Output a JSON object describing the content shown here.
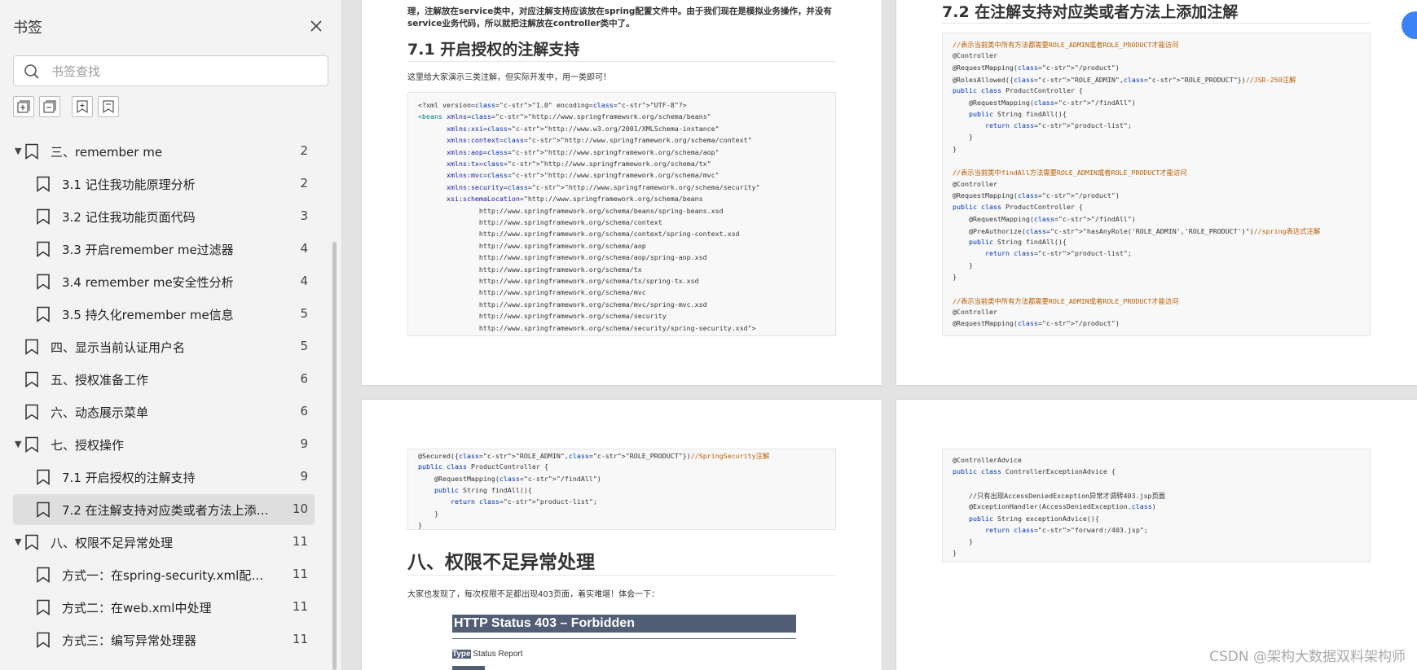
{
  "sidebar": {
    "title": "书签",
    "search_placeholder": "书签查找",
    "toolbar": [
      "expand-all",
      "collapse-all",
      "add-bookmark",
      "bookmark"
    ],
    "items": [
      {
        "label": "三、remember me",
        "page": "2",
        "level": 0,
        "expanded": true
      },
      {
        "label": "3.1 记住我功能原理分析",
        "page": "2",
        "level": 1
      },
      {
        "label": "3.2 记住我功能页面代码",
        "page": "3",
        "level": 1
      },
      {
        "label": "3.3 开启remember me过滤器",
        "page": "4",
        "level": 1
      },
      {
        "label": "3.4 remember me安全性分析",
        "page": "4",
        "level": 1
      },
      {
        "label": "3.5 持久化remember me信息",
        "page": "5",
        "level": 1
      },
      {
        "label": "四、显示当前认证用户名",
        "page": "5",
        "level": 0
      },
      {
        "label": "五、授权准备工作",
        "page": "6",
        "level": 0
      },
      {
        "label": "六、动态展示菜单",
        "page": "6",
        "level": 0
      },
      {
        "label": "七、授权操作",
        "page": "9",
        "level": 0,
        "expanded": true
      },
      {
        "label": "7.1 开启授权的注解支持",
        "page": "9",
        "level": 1
      },
      {
        "label": "7.2 在注解支持对应类或者方法上添加...",
        "page": "10",
        "level": 1,
        "active": true
      },
      {
        "label": "八、权限不足异常处理",
        "page": "11",
        "level": 0,
        "expanded": true
      },
      {
        "label": "方式一：在spring-security.xml配置文...",
        "page": "11",
        "level": 1
      },
      {
        "label": "方式二：在web.xml中处理",
        "page": "11",
        "level": 1
      },
      {
        "label": "方式三：编写异常处理器",
        "page": "11",
        "level": 1
      }
    ]
  },
  "page1": {
    "intro_lines": [
      "理，注解放在service类中，对应注解支持应该放在spring配置文件中。由于我们现在是模拟业务操作，并没有",
      "service业务代码，所以就把注解放在controller类中了。"
    ],
    "heading": "7.1 开启授权的注解支持",
    "para": "这里给大家演示三类注解，但实际开发中，用一类即可！",
    "code": [
      "<?xml version=\"1.0\" encoding=\"UTF-8\"?>",
      "<beans xmlns=\"http://www.springframework.org/schema/beans\"",
      "       xmlns:xsi=\"http://www.w3.org/2001/XMLSchema-instance\"",
      "       xmlns:context=\"http://www.springframework.org/schema/context\"",
      "       xmlns:aop=\"http://www.springframework.org/schema/aop\"",
      "       xmlns:tx=\"http://www.springframework.org/schema/tx\"",
      "       xmlns:mvc=\"http://www.springframework.org/schema/mvc\"",
      "       xmlns:security=\"http://www.springframework.org/schema/security\"",
      "       xsi:schemaLocation=\"http://www.springframework.org/schema/beans",
      "               http://www.springframework.org/schema/beans/spring-beans.xsd",
      "               http://www.springframework.org/schema/context",
      "               http://www.springframework.org/schema/context/spring-context.xsd",
      "               http://www.springframework.org/schema/aop",
      "               http://www.springframework.org/schema/aop/spring-aop.xsd",
      "               http://www.springframework.org/schema/tx",
      "               http://www.springframework.org/schema/tx/spring-tx.xsd",
      "               http://www.springframework.org/schema/mvc",
      "               http://www.springframework.org/schema/mvc/spring-mvc.xsd",
      "               http://www.springframework.org/schema/security",
      "               http://www.springframework.org/schema/security/spring-security.xsd\">"
    ]
  },
  "page2": {
    "heading": "7.2 在注解支持对应类或者方法上添加注解",
    "code": [
      "//表示当前类中所有方法都需要ROLE_ADMIN或者ROLE_PRODUCT才能访问",
      "@Controller",
      "@RequestMapping(\"/product\")",
      "@RolesAllowed({\"ROLE_ADMIN\",\"ROLE_PRODUCT\"})//JSR-250注解",
      "public class ProductController {",
      "    @RequestMapping(\"/findAll\")",
      "    public String findAll(){",
      "        return \"product-list\";",
      "    }",
      "}",
      "",
      "//表示当前类中findAll方法需要ROLE_ADMIN或者ROLE_PRODUCT才能访问",
      "@Controller",
      "@RequestMapping(\"/product\")",
      "public class ProductController {",
      "    @RequestMapping(\"/findAll\")",
      "    @PreAuthorize(\"hasAnyRole('ROLE_ADMIN','ROLE_PRODUCT')\")//spring表达式注解",
      "    public String findAll(){",
      "        return \"product-list\";",
      "    }",
      "}",
      "",
      "//表示当前类中所有方法都需要ROLE_ADMIN或者ROLE_PRODUCT才能访问",
      "@Controller",
      "@RequestMapping(\"/product\")"
    ]
  },
  "page3": {
    "code": [
      "@Secured({\"ROLE_ADMIN\",\"ROLE_PRODUCT\"})//SpringSecurity注解",
      "public class ProductController {",
      "    @RequestMapping(\"/findAll\")",
      "    public String findAll(){",
      "        return \"product-list\";",
      "    }",
      "}"
    ],
    "heading": "八、权限不足异常处理",
    "para": "大家也发现了，每次权限不足都出现403页面，着实难堪！体会一下：",
    "http_title": "HTTP Status 403 – Forbidden",
    "type_label": "Type",
    "type_value": "Status Report"
  },
  "page4": {
    "code": [
      "@ControllerAdvice",
      "public class ControllerExceptionAdvice {",
      "",
      "    //只有出现AccessDeniedException异常才调转403.jsp页面",
      "    @ExceptionHandler(AccessDeniedException.class)",
      "    public String exceptionAdvice(){",
      "        return \"forward:/403.jsp\";",
      "    }",
      "}"
    ]
  },
  "watermark": "CSDN @架构大数据双料架构师",
  "colors": {
    "accent": "#3b82f6",
    "active_row": "#dedede",
    "sidebar_bg": "#f3f3f3"
  }
}
